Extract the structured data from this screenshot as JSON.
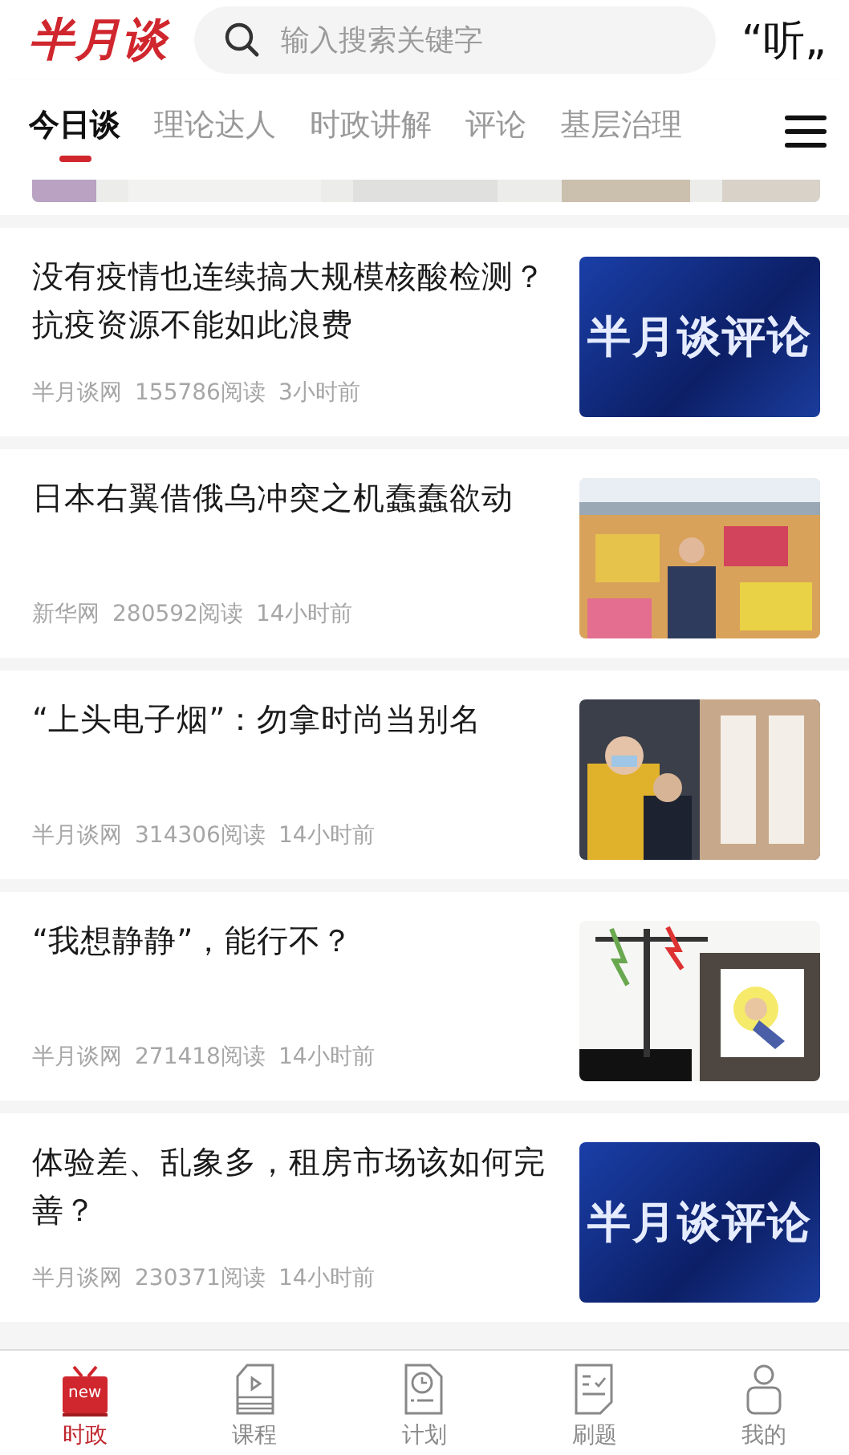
{
  "header": {
    "logo": "半月谈",
    "search": {
      "placeholder": "输入搜索关键字"
    },
    "listen_button": "“听„"
  },
  "tabs": [
    {
      "label": "今日谈",
      "selected": true
    },
    {
      "label": "理论达人",
      "selected": false
    },
    {
      "label": "时政讲解",
      "selected": false
    },
    {
      "label": "评论",
      "selected": false
    },
    {
      "label": "基层治理",
      "selected": false
    }
  ],
  "articles": [
    {
      "title": "没有疫情也连续搞大规模核酸检测？抗疫资源不能如此浪费",
      "source": "半月谈网",
      "reads": "155786阅读",
      "time": "3小时前",
      "thumbnail": {
        "kind": "banner",
        "text": "半月谈评论"
      }
    },
    {
      "title": "日本右翼借俄乌冲突之机蠢蠢欲动",
      "source": "新华网",
      "reads": "280592阅读",
      "time": "14小时前"
    },
    {
      "title": "“上头电子烟”：勿拿时尚当别名",
      "source": "半月谈网",
      "reads": "314306阅读",
      "time": "14小时前"
    },
    {
      "title": "“我想静静”，能行不？",
      "source": "半月谈网",
      "reads": "271418阅读",
      "time": "14小时前"
    },
    {
      "title": "体验差、乱象多，租房市场该如何完善？",
      "source": "半月谈网",
      "reads": "230371阅读",
      "time": "14小时前",
      "thumbnail": {
        "kind": "banner",
        "text": "半月谈评论"
      }
    }
  ],
  "bottom_nav": [
    {
      "label": "时政",
      "selected": true,
      "kind": "news",
      "badge": "new"
    },
    {
      "label": "课程",
      "selected": false,
      "kind": "course"
    },
    {
      "label": "计划",
      "selected": false,
      "kind": "plan"
    },
    {
      "label": "刷题",
      "selected": false,
      "kind": "quiz"
    },
    {
      "label": "我的",
      "selected": false,
      "kind": "profile"
    }
  ]
}
